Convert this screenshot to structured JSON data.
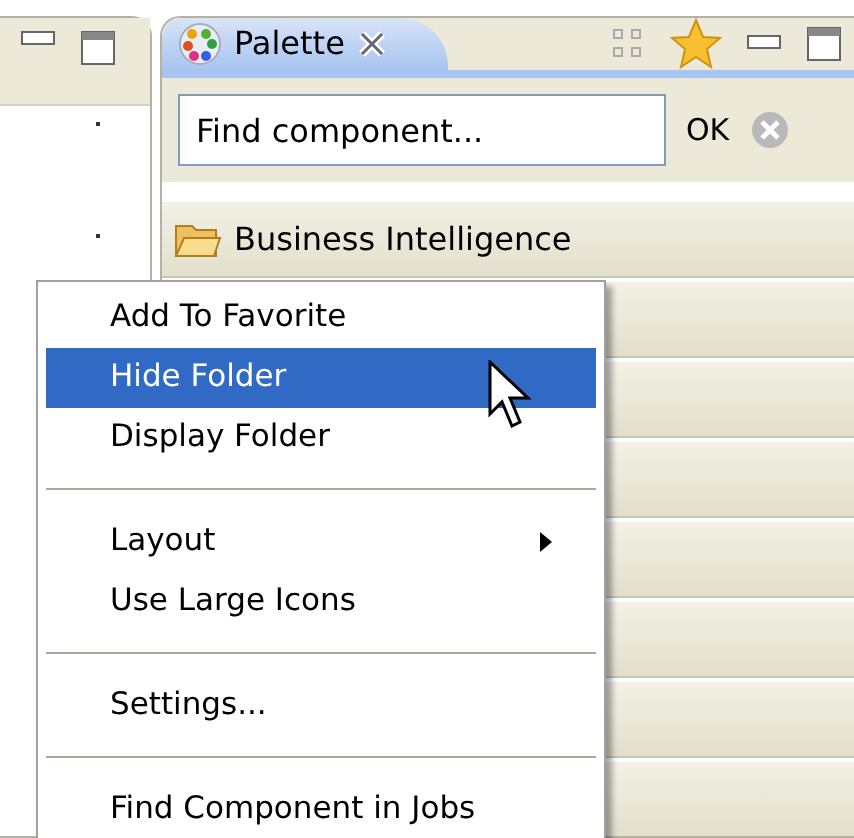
{
  "palette_tab": {
    "title": "Palette",
    "selected": true
  },
  "search": {
    "value": "Find component...",
    "button": "OK"
  },
  "drawers": [
    {
      "label": "Business Intelligence"
    }
  ],
  "context_menu": [
    {
      "kind": "item",
      "label": "Add To Favorite",
      "selected": false,
      "submenu": false
    },
    {
      "kind": "item",
      "label": "Hide Folder",
      "selected": true,
      "submenu": false
    },
    {
      "kind": "item",
      "label": "Display Folder",
      "selected": false,
      "submenu": false
    },
    {
      "kind": "separator"
    },
    {
      "kind": "item",
      "label": "Layout",
      "selected": false,
      "submenu": true
    },
    {
      "kind": "item",
      "label": "Use Large Icons",
      "selected": false,
      "submenu": false
    },
    {
      "kind": "separator"
    },
    {
      "kind": "item",
      "label": "Settings...",
      "selected": false,
      "submenu": false
    },
    {
      "kind": "separator"
    },
    {
      "kind": "item",
      "label": "Find Component in Jobs",
      "selected": false,
      "submenu": false
    }
  ]
}
